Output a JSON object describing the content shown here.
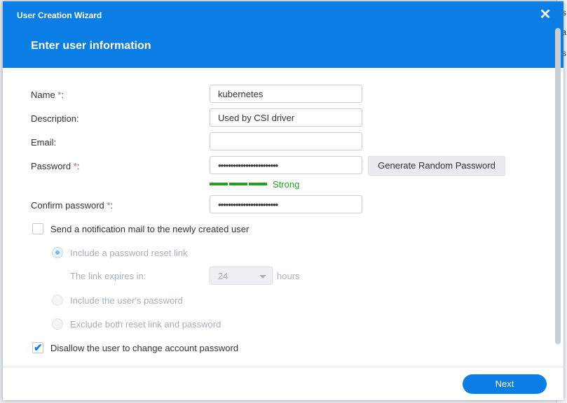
{
  "background": {
    "fragments": [
      "s",
      "ma",
      "s"
    ]
  },
  "window": {
    "title": "User Creation Wizard",
    "close_glyph": "✕",
    "close_icon": "close-icon"
  },
  "step": {
    "title": "Enter user information"
  },
  "form": {
    "name": {
      "label": "Name ",
      "required_mark": "*",
      "label_suffix": ":",
      "value": "kubernetes"
    },
    "description": {
      "label": "Description:",
      "value": "Used by CSI driver"
    },
    "email": {
      "label": "Email:",
      "value": ""
    },
    "password": {
      "label": "Password ",
      "required_mark": "*",
      "label_suffix": ":",
      "value": "••••••••••••••••••••••••"
    },
    "generate_button": "Generate Random Password",
    "strength": {
      "label": "Strong",
      "level": 3,
      "max": 3,
      "color": "#23a023"
    },
    "confirm_password": {
      "label": "Confirm password ",
      "required_mark": "*",
      "label_suffix": ":",
      "value": "••••••••••••••••••••••••"
    },
    "notify": {
      "label": "Send a notification mail to the newly created user",
      "checked": false,
      "options": [
        {
          "label": "Include a password reset link",
          "selected": true
        },
        {
          "label": "Include the user's password",
          "selected": false
        },
        {
          "label": "Exclude both reset link and password",
          "selected": false
        }
      ],
      "link_expiry": {
        "label": "The link expires in:",
        "value": "24",
        "unit": "hours"
      }
    },
    "disallow_change": {
      "label": "Disallow the user to change account password",
      "checked": true,
      "check_glyph": "✔"
    }
  },
  "footer": {
    "next_button": "Next"
  },
  "colors": {
    "accent": "#0a7ee5",
    "required": "#d9534f",
    "disabled_text": "#a8b0b8"
  }
}
